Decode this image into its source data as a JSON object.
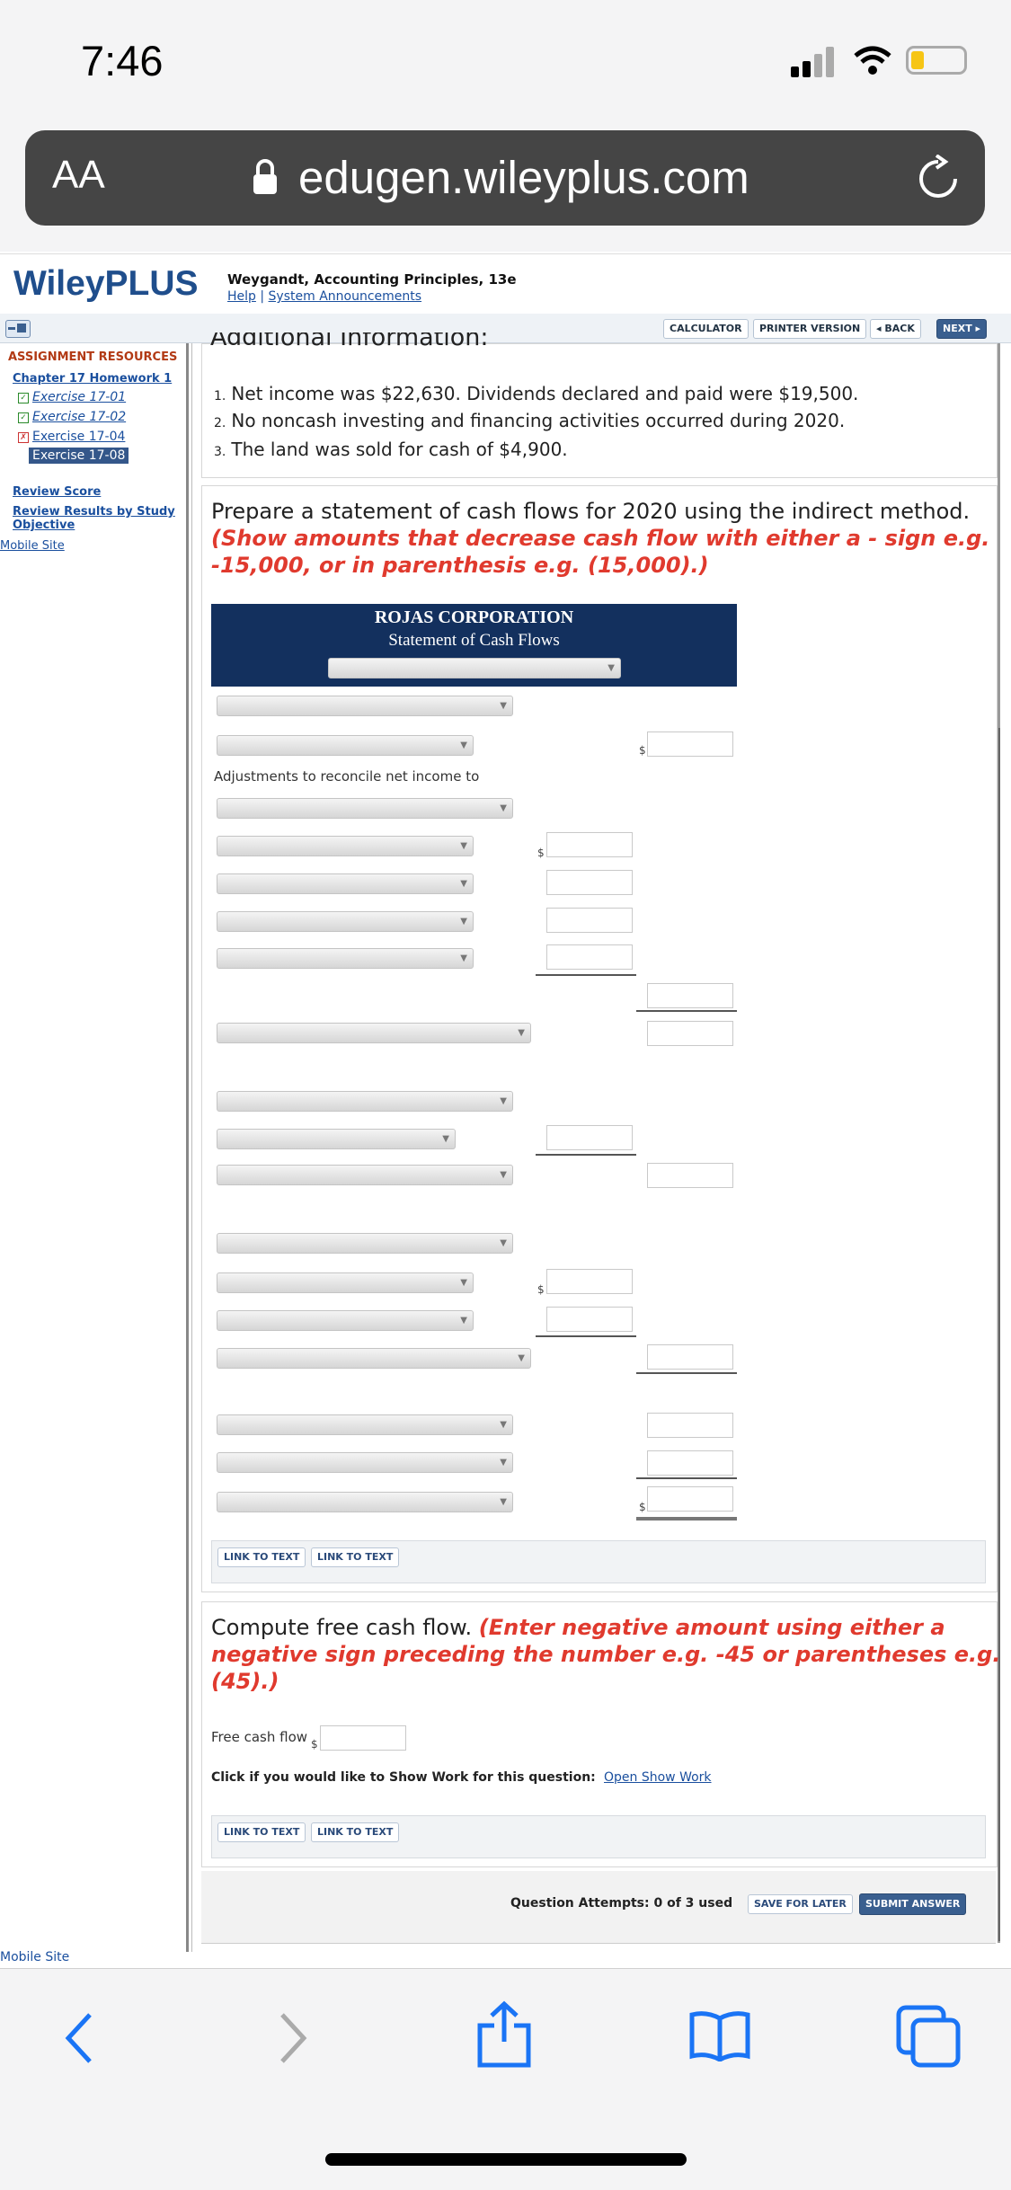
{
  "status_bar": {
    "time": "7:46"
  },
  "browser": {
    "text_size_label": "AA",
    "url": "edugen.wileyplus.com",
    "icons": [
      "lock-icon",
      "reload-icon"
    ]
  },
  "header": {
    "logo": "WileyPLUS",
    "book_title": "Weygandt, Accounting Principles, 13e",
    "help": "Help",
    "separator": "|",
    "announcements": "System Announcements"
  },
  "toolbar": {
    "calculator": "CALCULATOR",
    "printer": "PRINTER VERSION",
    "back": "◂ BACK",
    "next": "NEXT ▸"
  },
  "sidebar": {
    "heading": "ASSIGNMENT RESOURCES",
    "chapter": "Chapter 17 Homework 1",
    "exercises": [
      "Exercise 17-01",
      "Exercise 17-02",
      "Exercise 17-04",
      "Exercise 17-08"
    ],
    "review_score": "Review Score",
    "review_results_1": "Review Results by Study",
    "review_results_2": "Objective",
    "mobile_site": "Mobile Site"
  },
  "additional": {
    "heading_partial": "Additional Information:",
    "items": [
      "Net income was $22,630. Dividends declared and paid were $19,500.",
      "No noncash investing and financing activities occurred during 2020.",
      "The land was sold for cash of $4,900."
    ],
    "nums": [
      "1.",
      "2.",
      "3."
    ]
  },
  "question1": {
    "line1": "Prepare a statement of cash flows for 2020 using the indirect method.",
    "red1": "(Show amounts that decrease cash flow with either a - sign e.g.",
    "red2": "-15,000, or in parenthesis e.g. (15,000).)"
  },
  "statement": {
    "company": "ROJAS CORPORATION",
    "title": "Statement of Cash Flows",
    "adjust_label": "Adjustments to reconcile net income to",
    "currency": "$"
  },
  "link_to_text": "LINK TO TEXT",
  "question2": {
    "line1": "Compute free cash flow.",
    "red1": "(Enter negative amount using either a",
    "red2": "negative sign preceding the number e.g. -45 or parentheses e.g.",
    "red3": "(45).)",
    "fcf_label": "Free cash flow",
    "show_work_prompt": "Click if you would like to Show Work for this question:",
    "show_work_link": "Open Show Work"
  },
  "footer": {
    "attempts": "Question Attempts: 0 of 3 used",
    "save": "SAVE FOR LATER",
    "submit": "SUBMIT ANSWER",
    "mobile_site": "Mobile Site"
  },
  "safari_nav": {
    "icons": [
      "back-icon",
      "forward-icon",
      "share-icon",
      "bookmarks-icon",
      "tabs-icon"
    ]
  }
}
